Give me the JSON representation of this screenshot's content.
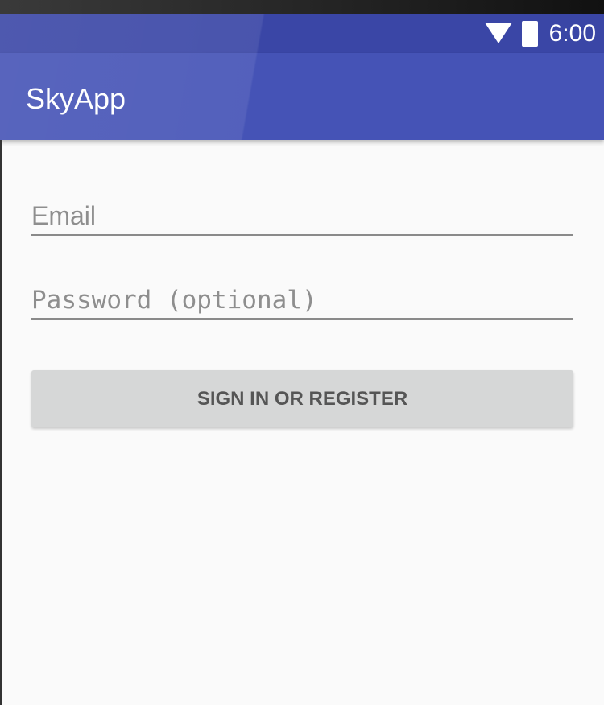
{
  "status_bar": {
    "time": "6:00"
  },
  "app_bar": {
    "title": "SkyApp"
  },
  "form": {
    "email_placeholder": "Email",
    "password_placeholder": "Password (optional)",
    "submit_label": "SIGN IN OR REGISTER"
  }
}
